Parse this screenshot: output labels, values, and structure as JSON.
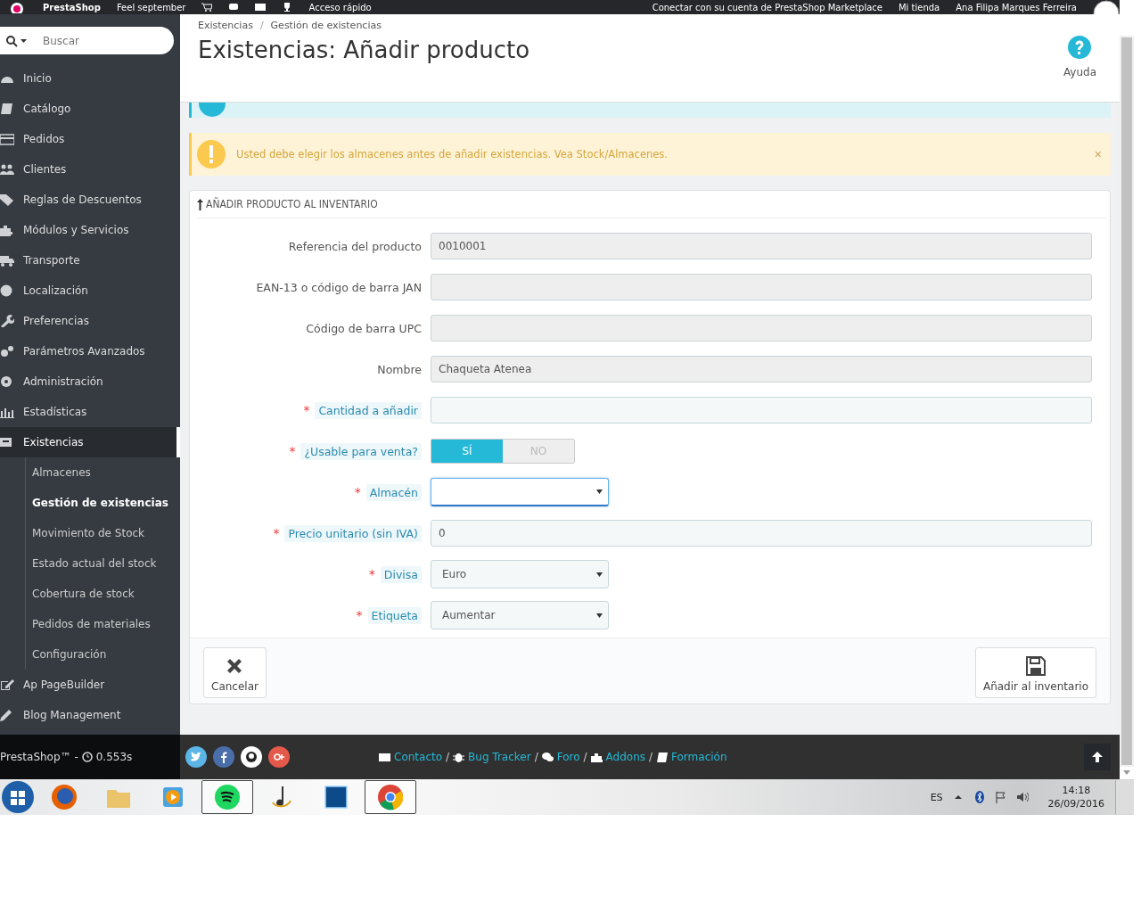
{
  "top_bar": {
    "brand": "PrestaShop",
    "shop_name": "Feel september",
    "quick_access": "Acceso rápido",
    "marketplace": "Conectar con su cuenta de PrestaShop Marketplace",
    "my_shop": "Mi tienda",
    "employee": "Ana Filipa Marques Ferreira"
  },
  "sidebar": {
    "search": {
      "placeholder": "Buscar"
    },
    "items": [
      {
        "label": "Inicio",
        "selected": false
      },
      {
        "label": "Catálogo",
        "selected": false
      },
      {
        "label": "Pedidos",
        "selected": false
      },
      {
        "label": "Clientes",
        "selected": false
      },
      {
        "label": "Reglas de Descuentos",
        "selected": false
      },
      {
        "label": "Módulos y Servicios",
        "selected": false
      },
      {
        "label": "Transporte",
        "selected": false
      },
      {
        "label": "Localización",
        "selected": false
      },
      {
        "label": "Preferencias",
        "selected": false
      },
      {
        "label": "Parámetros Avanzados",
        "selected": false
      },
      {
        "label": "Administración",
        "selected": false
      },
      {
        "label": "Estadísticas",
        "selected": false
      },
      {
        "label": "Existencias",
        "selected": true,
        "children": [
          {
            "label": "Almacenes",
            "selected": false
          },
          {
            "label": "Gestión de existencias",
            "selected": true
          },
          {
            "label": "Movimiento de Stock",
            "selected": false
          },
          {
            "label": "Estado actual del stock",
            "selected": false
          },
          {
            "label": "Cobertura de stock",
            "selected": false
          },
          {
            "label": "Pedidos de materiales",
            "selected": false
          },
          {
            "label": "Configuración",
            "selected": false
          }
        ]
      },
      {
        "label": "Ap PageBuilder",
        "selected": false
      },
      {
        "label": "Blog Management",
        "selected": false
      }
    ]
  },
  "header": {
    "breadcrumb": [
      "Existencias",
      "Gestión de existencias"
    ],
    "breadcrumb_separator": "/",
    "title": "Existencias: Añadir producto",
    "help": "Ayuda"
  },
  "alerts": [
    {
      "kind": "info"
    },
    {
      "kind": "warning",
      "text": "Usted debe elegir los almacenes antes de añadir existencias. Vea Stock/Almacenes.",
      "close": "×"
    }
  ],
  "panel": {
    "title": "AÑADIR PRODUCTO AL INVENTARIO",
    "fields": [
      {
        "kind": "readonly",
        "label": "Referencia del producto",
        "value": "0010001"
      },
      {
        "kind": "readonly",
        "label": "EAN-13 o código de barra JAN"
      },
      {
        "kind": "readonly",
        "label": "Código de barra UPC"
      },
      {
        "kind": "readonly",
        "label": "Nombre",
        "value": "Chaqueta Atenea"
      },
      {
        "kind": "input",
        "label": "Cantidad a añadir",
        "required_mark": "*"
      },
      {
        "kind": "switch",
        "label": "¿Usable para venta?",
        "required_mark": "*",
        "options": [
          {
            "label": "SÍ",
            "selected": true
          },
          {
            "label": "NO",
            "selected": false
          }
        ]
      },
      {
        "kind": "select",
        "label": "Almacén",
        "required_mark": "*",
        "focused": true
      },
      {
        "kind": "input",
        "label": "Precio unitario (sin IVA)",
        "required_mark": "*",
        "value": "0"
      },
      {
        "kind": "select",
        "label": "Divisa",
        "required_mark": "*",
        "focused": false,
        "value": "Euro"
      },
      {
        "kind": "select",
        "label": "Etiqueta",
        "required_mark": "*",
        "focused": false,
        "value": "Aumentar"
      }
    ],
    "buttons": [
      {
        "kind": "cancel",
        "label": "Cancelar"
      },
      {
        "kind": "save",
        "label": "Añadir al inventario"
      }
    ]
  },
  "footer": {
    "brand": "PrestaShop™ -",
    "load_time": "0.553s",
    "links": [
      "Contacto",
      "Bug Tracker",
      "Foro",
      "Addons",
      "Formación"
    ],
    "link_separator": "/"
  },
  "taskbar": {
    "apps": [
      {
        "active": false
      },
      {
        "active": false
      },
      {
        "active": false
      },
      {
        "active": true
      },
      {
        "active": false
      },
      {
        "active": false
      },
      {
        "active": true
      }
    ],
    "language": "ES",
    "time": "14:18",
    "date": "26/09/2016"
  }
}
